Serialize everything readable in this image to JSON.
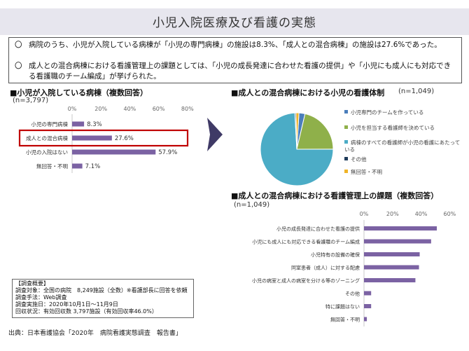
{
  "title": "小児入院医療及び看護の実態",
  "summary": {
    "bullets": [
      {
        "mark": "〇",
        "text": "病院のうち、小児が入院している病棟が「小児の専門病棟」の施設は8.3%、「成人との混合病棟」の施設は27.6%であった。"
      },
      {
        "mark": "〇",
        "text": "成人との混合病棟における看護管理上の課題としては、「小児の成長発達に合わせた看護の提供」や「小児にも成人にも対応できる看護職のチーム編成」が挙げられた。"
      }
    ]
  },
  "colors": {
    "bar": "#7b62a3",
    "pie_1": "#4a7ebb",
    "pie_2": "#8fb04a",
    "pie_3": "#4bacc6",
    "pie_4": "#1f3b5a",
    "pie_5": "#f0b428",
    "highlight": "#c00000",
    "arrow": "#3f3a66"
  },
  "chart1": {
    "title": "■小児が入院している病棟（複数回答）",
    "n": "(n=3,797)"
  },
  "chart2": {
    "title": "■成人との混合病棟における小児の看護体制",
    "n": "(n=1,049)"
  },
  "chart3": {
    "title": "■成人との混合病棟における看護管理上の課題（複数回答）",
    "n": "(n=1,049)"
  },
  "survey": {
    "lines": [
      "【調査概要】",
      "調査対象：全国の病院　8,249施設（全数）※看護部長に回答を依頼",
      "調査手法：Web調査",
      "調査実施日：2020年10月1日～11月9日",
      "回収状況：有効回収数 3,797施設（有効回収率46.0%）"
    ]
  },
  "source": "出典：日本看護協会「2020年　病院看護実態調査　報告書」",
  "chart_data": [
    {
      "type": "bar",
      "orientation": "horizontal",
      "categories": [
        "小児の専門病棟",
        "成人との混合病棟",
        "小児の入院はない",
        "無回答・不明"
      ],
      "values": [
        8.3,
        27.6,
        57.9,
        7.1
      ],
      "value_labels": [
        "8.3%",
        "27.6%",
        "57.9%",
        "7.1%"
      ],
      "xticks": [
        "0%",
        "20%",
        "40%",
        "60%",
        "80%"
      ],
      "xlim": [
        0,
        80
      ],
      "highlight": "成人との混合病棟"
    },
    {
      "type": "pie",
      "categories": [
        "小児専門のチームを作っている",
        "小児を担当する看護師を決めている",
        "病棟のすべての看護師が小児の看護にあたっている",
        "その他",
        "無回答・不明"
      ],
      "values": [
        2.7,
        21.3,
        74.2,
        0.5,
        1.3
      ],
      "legend_position": "right"
    },
    {
      "type": "bar",
      "orientation": "horizontal",
      "categories": [
        "小児の成長発達に合わせた看護の提供",
        "小児にも成人にも対応できる看護職のチーム編成",
        "小児特有の設備の確保",
        "同室患者（成人）に対する配慮",
        "小児の病室と成人の病室を分ける等のゾーニング",
        "その他",
        "特に課題はない",
        "無回答・不明"
      ],
      "values": [
        51,
        47,
        39,
        38.5,
        36,
        5,
        5,
        2
      ],
      "xticks": [
        "0%",
        "20%",
        "40%",
        "60%"
      ],
      "xlim": [
        0,
        60
      ]
    }
  ]
}
